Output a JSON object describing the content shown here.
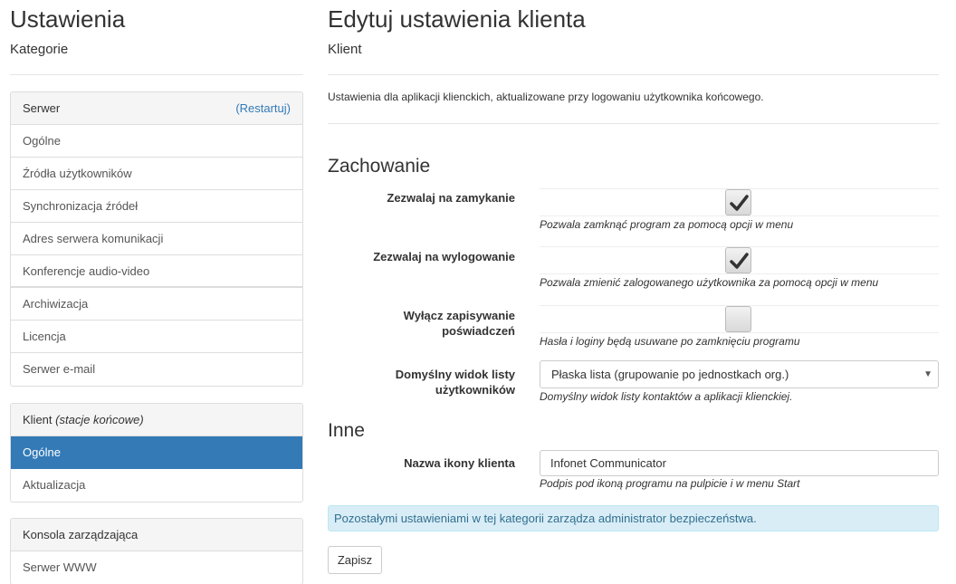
{
  "sidebar": {
    "title": "Ustawienia",
    "subtitle": "Kategorie",
    "groups": [
      {
        "header": "Serwer",
        "header_action": "(Restartuj)",
        "items": [
          "Ogólne",
          "Źródła użytkowników",
          "Synchronizacja źródeł",
          "Adres serwera komunikacji",
          "Konferencje audio-video",
          "Archiwizacja",
          "Licencja",
          "Serwer e-mail"
        ]
      },
      {
        "header": "Klient",
        "header_em": "(stacje końcowe)",
        "items": [
          "Ogólne",
          "Aktualizacja"
        ],
        "active_index": 0
      },
      {
        "header": "Konsola zarządzająca",
        "items": [
          "Serwer WWW"
        ]
      }
    ]
  },
  "main": {
    "title": "Edytuj ustawienia klienta",
    "subtitle": "Klient",
    "description": "Ustawienia dla aplikacji klienckich, aktualizowane przy logowaniu użytkownika końcowego.",
    "sections": {
      "behavior": {
        "title": "Zachowanie",
        "fields": [
          {
            "label": "Zezwalaj na zamykanie",
            "checked": true,
            "help": "Pozwala zamknąć program za pomocą opcji w menu"
          },
          {
            "label": "Zezwalaj na wylogowanie",
            "checked": true,
            "help": "Pozwala zmienić zalogowanego użytkownika za pomocą opcji w menu"
          },
          {
            "label": "Wyłącz zapisywanie poświadczeń",
            "checked": false,
            "help": "Hasła i loginy będą usuwane po zamknięciu programu"
          }
        ],
        "select": {
          "label_line1": "Domyślny widok listy",
          "label_line2": "użytkowników",
          "value": "Płaska lista (grupowanie po jednostkach org.)",
          "help": "Domyślny widok listy kontaktów a aplikacji klienckiej."
        }
      },
      "other": {
        "title": "Inne",
        "icon_name": {
          "label": "Nazwa ikony klienta",
          "value": "Infonet Communicator",
          "help": "Podpis pod ikoną programu na pulpicie i w menu Start"
        }
      }
    },
    "alert": "Pozostałymi ustawieniami w tej kategorii zarządza administrator bezpieczeństwa.",
    "save_label": "Zapisz"
  },
  "icons": {
    "checkmark": "checkmark-icon",
    "dropdown": "caret-down-icon"
  },
  "colors": {
    "accent": "#337ab7",
    "alert_bg": "#d9edf7",
    "alert_text": "#31708f"
  }
}
